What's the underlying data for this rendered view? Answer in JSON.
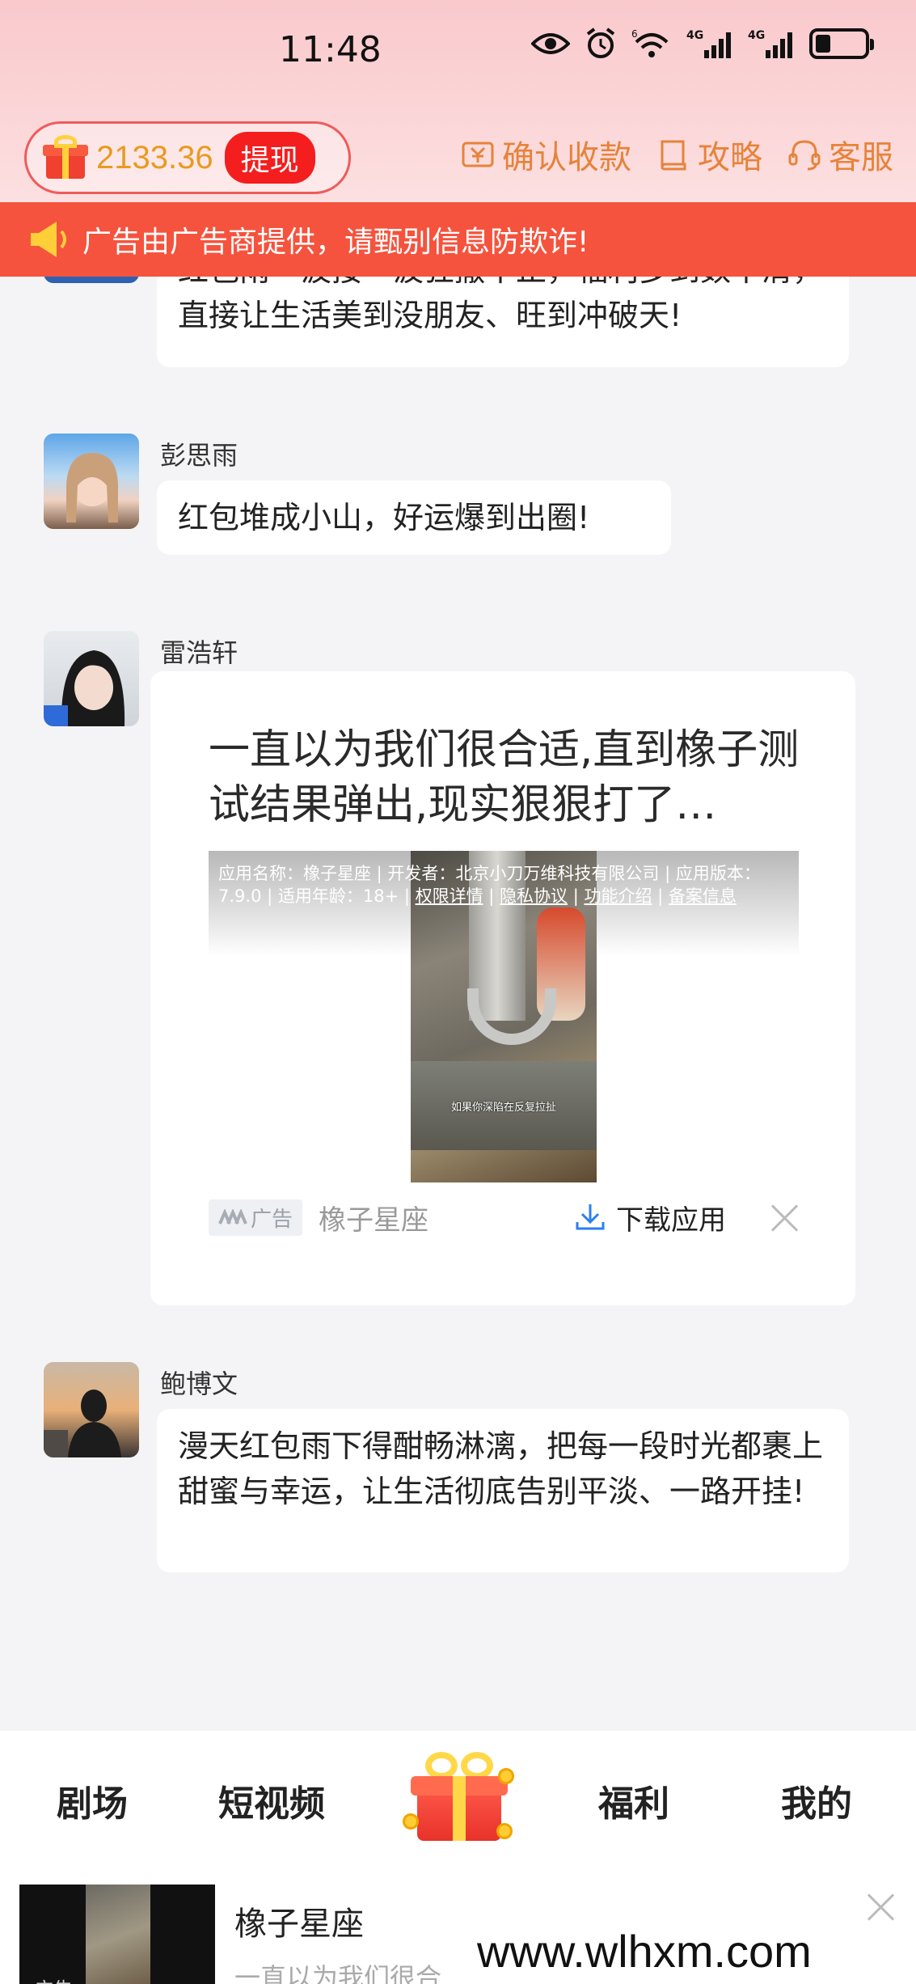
{
  "status_bar": {
    "time": "11:48",
    "net1": "4G",
    "net2": "4G",
    "wifi_badge": "6"
  },
  "header": {
    "balance": "2133.36",
    "withdraw_label": "提现",
    "links": [
      {
        "label": "确认收款",
        "icon": "receipt-icon"
      },
      {
        "label": "攻略",
        "icon": "guide-book-icon"
      },
      {
        "label": "客服",
        "icon": "headset-icon"
      }
    ],
    "accent_color": "#e6833a"
  },
  "notice": {
    "text": "广告由广告商提供，请甄别信息防欺诈!",
    "color": "#f5533d"
  },
  "messages": [
    {
      "user": "",
      "text": "红包雨一波接一波狂撒不止，福利多到数不清，直接让生活美到没朋友、旺到冲破天!"
    },
    {
      "user": "彭思雨",
      "text": "红包堆成小山，好运爆到出圈!"
    },
    {
      "user": "雷浩轩",
      "text": ""
    },
    {
      "user": "鲍博文",
      "text": "漫天红包雨下得酣畅淋漓，把每一段时光都裹上甜蜜与幸运，让生活彻底告别平淡、一路开挂!"
    }
  ],
  "ad": {
    "headline": "一直以为我们很合适,直到橡子测试结果弹出,现实狠狠打了…",
    "info_prefix": "应用名称：橡子星座 | 开发者：北京小刀万维科技有限公司 | 应用版本：7.9.0 | 适用年龄：18+ | ",
    "info_links": [
      "权限详情",
      "隐私协议",
      "功能介绍",
      "备案信息"
    ],
    "video_caption": "如果你深陷在反复拉扯",
    "tag": "广告",
    "brand": "橡子星座",
    "download_label": "下载应用"
  },
  "bottom_nav": [
    {
      "label": "剧场"
    },
    {
      "label": "短视频"
    },
    {
      "label": "福利"
    },
    {
      "label": "我的"
    }
  ],
  "bottom_ad": {
    "title": "橡子星座",
    "subtitle": "一直以为我们很合",
    "tag": "广告"
  },
  "watermark": "www.wlhxm.com"
}
